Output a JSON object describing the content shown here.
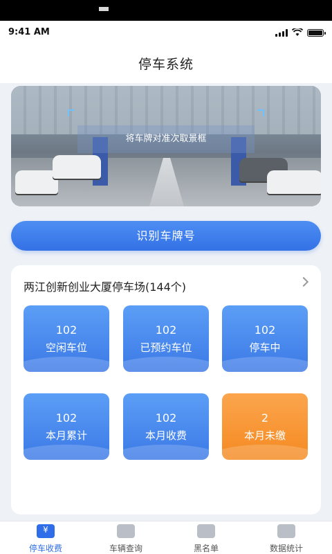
{
  "status_bar": {
    "time": "9:41 AM"
  },
  "header": {
    "title": "停车系统"
  },
  "camera": {
    "hint": "将车牌对准次取景框"
  },
  "recognize_button": "识别车牌号",
  "lot": {
    "title": "两江创新创业大厦停车场(144个)",
    "stats": [
      {
        "value": "102",
        "label": "空闲车位"
      },
      {
        "value": "102",
        "label": "已预约车位"
      },
      {
        "value": "102",
        "label": "停车中"
      },
      {
        "value": "102",
        "label": "本月累计"
      },
      {
        "value": "102",
        "label": "本月收费"
      },
      {
        "value": "2",
        "label": "本月未缴"
      }
    ]
  },
  "tabs": [
    {
      "label": "停车收费",
      "icon": "yen-icon"
    },
    {
      "label": "车辆查询",
      "icon": "car-icon"
    },
    {
      "label": "黑名单",
      "icon": "blacklist-icon"
    },
    {
      "label": "数据统计",
      "icon": "stats-icon"
    }
  ],
  "colors": {
    "primary": "#3a7be8",
    "accent_orange": "#f7922e"
  }
}
